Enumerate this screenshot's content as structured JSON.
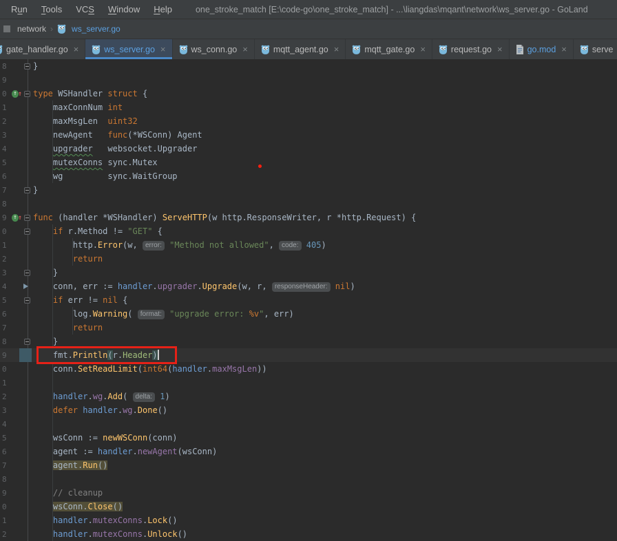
{
  "window": {
    "title": "one_stroke_match [E:\\code-go\\one_stroke_match] - ...\\liangdas\\mqant\\network\\ws_server.go - GoLand"
  },
  "menu": {
    "items": [
      {
        "label": "Run",
        "mnemonic_index": 1
      },
      {
        "label": "Tools",
        "mnemonic_index": 0
      },
      {
        "label": "VCS",
        "mnemonic_index": 2
      },
      {
        "label": "Window",
        "mnemonic_index": 0
      },
      {
        "label": "Help",
        "mnemonic_index": 0
      }
    ]
  },
  "breadcrumbs": {
    "items": [
      {
        "label": "network",
        "modified": false,
        "icon": null
      },
      {
        "label": "ws_server.go",
        "modified": true,
        "icon": "go"
      }
    ]
  },
  "tabs": [
    {
      "label": "gate_handler.go",
      "icon": "go",
      "modified": false,
      "active": false,
      "clipped_left": true
    },
    {
      "label": "ws_server.go",
      "icon": "go",
      "modified": true,
      "active": true,
      "clipped_left": false
    },
    {
      "label": "ws_conn.go",
      "icon": "go",
      "modified": false,
      "active": false,
      "clipped_left": false
    },
    {
      "label": "mqtt_agent.go",
      "icon": "go",
      "modified": false,
      "active": false,
      "clipped_left": false
    },
    {
      "label": "mqtt_gate.go",
      "icon": "go",
      "modified": false,
      "active": false,
      "clipped_left": false
    },
    {
      "label": "request.go",
      "icon": "go",
      "modified": false,
      "active": false,
      "clipped_left": false
    },
    {
      "label": "go.mod",
      "icon": "gomod",
      "modified": true,
      "active": false,
      "clipped_left": false
    },
    {
      "label": "serve",
      "icon": "go",
      "modified": false,
      "active": false,
      "clipped_left": false
    }
  ],
  "colors": {
    "panel_bg": "#3c3f41",
    "editor_bg": "#2b2b2b",
    "caret_row_bg": "#323232",
    "accent_blue": "#5ca0e0",
    "tab_underline": "#4a88c7",
    "keyword": "#cc7832",
    "function_call": "#ffc66d",
    "string": "#6a8759",
    "number": "#6897bb",
    "receiver": "#6d9dd3",
    "struct_field": "#9876aa",
    "comment": "#808080",
    "plain_text": "#a9b7c6",
    "line_number": "#606366",
    "annotation_red": "#e62117",
    "usage_highlight_bg": "#534f38",
    "brace_match_bg": "#3b514d"
  },
  "editor": {
    "icons": {
      "impl_glyph": "↑",
      "red_arrow_glyph": "↑"
    },
    "lines": [
      {
        "num": "8",
        "fold": "end",
        "tokens": [
          {
            "t": "}"
          }
        ]
      },
      {
        "num": "9",
        "tokens": []
      },
      {
        "num": "0",
        "impl": true,
        "fold": "start",
        "tokens": [
          {
            "t": "type ",
            "c": "kw"
          },
          {
            "t": "WSHandler "
          },
          {
            "t": "struct ",
            "c": "kw"
          },
          {
            "t": "{"
          }
        ]
      },
      {
        "num": "1",
        "tokens": [
          {
            "t": "    maxConnNum "
          },
          {
            "t": "int",
            "c": "kw"
          }
        ]
      },
      {
        "num": "2",
        "tokens": [
          {
            "t": "    maxMsgLen  "
          },
          {
            "t": "uint32",
            "c": "kw"
          }
        ]
      },
      {
        "num": "3",
        "tokens": [
          {
            "t": "    newAgent   "
          },
          {
            "t": "func",
            "c": "kw"
          },
          {
            "t": "(*WSConn) Agent"
          }
        ]
      },
      {
        "num": "4",
        "tokens": [
          {
            "t": "    "
          },
          {
            "t": "upgrader",
            "wavy": true
          },
          {
            "t": "   websocket.Upgrader"
          }
        ]
      },
      {
        "num": "5",
        "tokens": [
          {
            "t": "    "
          },
          {
            "t": "mutexConns",
            "wavy": true
          },
          {
            "t": " sync.Mutex"
          }
        ]
      },
      {
        "num": "6",
        "tokens": [
          {
            "t": "    wg         sync.WaitGroup"
          }
        ]
      },
      {
        "num": "7",
        "fold": "end",
        "tokens": [
          {
            "t": "}"
          }
        ]
      },
      {
        "num": "8",
        "tokens": []
      },
      {
        "num": "9",
        "impl": true,
        "fold": "start",
        "tokens": [
          {
            "t": "func ",
            "c": "kw"
          },
          {
            "t": "(handler *WSHandler) "
          },
          {
            "t": "ServeHTTP",
            "c": "fn"
          },
          {
            "t": "(w http.ResponseWriter, r *http.Request) {"
          }
        ]
      },
      {
        "num": "0",
        "fold": "start",
        "tokens": [
          {
            "t": "    "
          },
          {
            "t": "if ",
            "c": "kw"
          },
          {
            "t": "r.Method != "
          },
          {
            "t": "\"GET\"",
            "c": "str"
          },
          {
            "t": " {"
          }
        ]
      },
      {
        "num": "1",
        "tokens": [
          {
            "t": "        http."
          },
          {
            "t": "Error",
            "c": "fn"
          },
          {
            "t": "(w, "
          },
          {
            "i": "error:"
          },
          {
            "t": " "
          },
          {
            "t": "\"Method not allowed\"",
            "c": "str"
          },
          {
            "t": ", "
          },
          {
            "i": "code:"
          },
          {
            "t": " "
          },
          {
            "t": "405",
            "c": "num"
          },
          {
            "t": ")"
          }
        ]
      },
      {
        "num": "2",
        "tokens": [
          {
            "t": "        "
          },
          {
            "t": "return",
            "c": "kw"
          }
        ]
      },
      {
        "num": "3",
        "fold": "end",
        "tokens": [
          {
            "t": "    }"
          }
        ]
      },
      {
        "num": "4",
        "triangle": true,
        "tokens": [
          {
            "t": "    conn, err := "
          },
          {
            "t": "handler",
            "c": "rcv"
          },
          {
            "t": "."
          },
          {
            "t": "upgrader",
            "c": "fld"
          },
          {
            "t": "."
          },
          {
            "t": "Upgrade",
            "c": "fn"
          },
          {
            "t": "(w, r, "
          },
          {
            "i": "responseHeader:"
          },
          {
            "t": " "
          },
          {
            "t": "nil",
            "c": "kw"
          },
          {
            "t": ")"
          }
        ]
      },
      {
        "num": "5",
        "fold": "start",
        "tokens": [
          {
            "t": "    "
          },
          {
            "t": "if ",
            "c": "kw"
          },
          {
            "t": "err != "
          },
          {
            "t": "nil",
            "c": "kw"
          },
          {
            "t": " {"
          }
        ]
      },
      {
        "num": "6",
        "tokens": [
          {
            "t": "        log."
          },
          {
            "t": "Warning",
            "c": "fn"
          },
          {
            "t": "( "
          },
          {
            "i": "format:"
          },
          {
            "t": " "
          },
          {
            "t": "\"upgrade error: ",
            "c": "str"
          },
          {
            "t": "%v",
            "c": "kw"
          },
          {
            "t": "\"",
            "c": "str"
          },
          {
            "t": ", err)"
          }
        ]
      },
      {
        "num": "7",
        "tokens": [
          {
            "t": "        "
          },
          {
            "t": "return",
            "c": "kw"
          }
        ]
      },
      {
        "num": "8",
        "fold": "end",
        "tokens": [
          {
            "t": "    }"
          }
        ]
      },
      {
        "num": "9",
        "current": true,
        "changebar": true,
        "redbox": true,
        "tokens": [
          {
            "t": "    fmt."
          },
          {
            "t": "Println",
            "c": "fn"
          },
          {
            "t": "(",
            "bg": "brace"
          },
          {
            "t": "r."
          },
          {
            "t": "Header",
            "c": "hdr"
          },
          {
            "t": ")",
            "bg": "brace"
          },
          {
            "caret": true
          }
        ]
      },
      {
        "num": "0",
        "tokens": [
          {
            "t": "    conn."
          },
          {
            "t": "SetReadLimit",
            "c": "fn"
          },
          {
            "t": "("
          },
          {
            "t": "int64",
            "c": "kw"
          },
          {
            "t": "("
          },
          {
            "t": "handler",
            "c": "rcv"
          },
          {
            "t": "."
          },
          {
            "t": "maxMsgLen",
            "c": "fld"
          },
          {
            "t": "))"
          }
        ]
      },
      {
        "num": "1",
        "tokens": []
      },
      {
        "num": "2",
        "tokens": [
          {
            "t": "    "
          },
          {
            "t": "handler",
            "c": "rcv"
          },
          {
            "t": "."
          },
          {
            "t": "wg",
            "c": "fld"
          },
          {
            "t": "."
          },
          {
            "t": "Add",
            "c": "fn"
          },
          {
            "t": "( "
          },
          {
            "i": "delta:"
          },
          {
            "t": " "
          },
          {
            "t": "1",
            "c": "num"
          },
          {
            "t": ")"
          }
        ]
      },
      {
        "num": "3",
        "tokens": [
          {
            "t": "    "
          },
          {
            "t": "defer ",
            "c": "kw"
          },
          {
            "t": "handler",
            "c": "rcv"
          },
          {
            "t": "."
          },
          {
            "t": "wg",
            "c": "fld"
          },
          {
            "t": "."
          },
          {
            "t": "Done",
            "c": "fn"
          },
          {
            "t": "()"
          }
        ]
      },
      {
        "num": "4",
        "tokens": []
      },
      {
        "num": "5",
        "tokens": [
          {
            "t": "    wsConn := "
          },
          {
            "t": "newWSConn",
            "c": "fn"
          },
          {
            "t": "(conn)"
          }
        ]
      },
      {
        "num": "6",
        "tokens": [
          {
            "t": "    agent := "
          },
          {
            "t": "handler",
            "c": "rcv"
          },
          {
            "t": "."
          },
          {
            "t": "newAgent",
            "c": "fld"
          },
          {
            "t": "(wsConn)"
          }
        ]
      },
      {
        "num": "7",
        "tokens": [
          {
            "t": "    "
          },
          {
            "t": "agent.",
            "bg": "usage"
          },
          {
            "t": "Run",
            "c": "fn",
            "bg": "usage"
          },
          {
            "t": "()",
            "bg": "usage"
          }
        ]
      },
      {
        "num": "8",
        "tokens": []
      },
      {
        "num": "9",
        "tokens": [
          {
            "t": "    "
          },
          {
            "t": "// cleanup",
            "c": "cmt"
          }
        ]
      },
      {
        "num": "0",
        "tokens": [
          {
            "t": "    "
          },
          {
            "t": "wsConn.",
            "bg": "usage"
          },
          {
            "t": "Close",
            "c": "fn",
            "bg": "usage"
          },
          {
            "t": "()",
            "bg": "usage"
          }
        ]
      },
      {
        "num": "1",
        "tokens": [
          {
            "t": "    "
          },
          {
            "t": "handler",
            "c": "rcv"
          },
          {
            "t": "."
          },
          {
            "t": "mutexConns",
            "c": "fld"
          },
          {
            "t": "."
          },
          {
            "t": "Lock",
            "c": "fn"
          },
          {
            "t": "()"
          }
        ]
      },
      {
        "num": "2",
        "tokens": [
          {
            "t": "    "
          },
          {
            "t": "handler",
            "c": "rcv"
          },
          {
            "t": "."
          },
          {
            "t": "mutexConns",
            "c": "fld"
          },
          {
            "t": "."
          },
          {
            "t": "Unlock",
            "c": "fn"
          },
          {
            "t": "()"
          }
        ]
      }
    ]
  }
}
